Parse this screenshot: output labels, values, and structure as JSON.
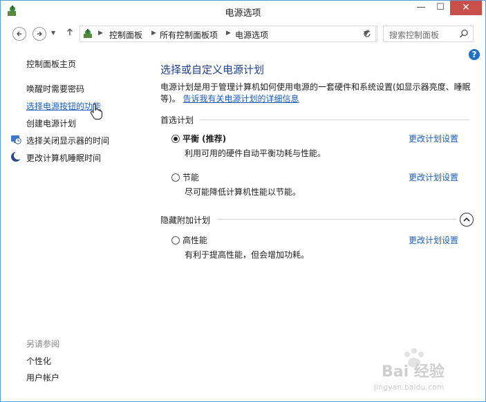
{
  "window": {
    "title": "电源选项",
    "minimize": "—",
    "maximize": "☐",
    "close": "✕"
  },
  "nav": {
    "back_icon": "arrow-left-icon",
    "forward_icon": "arrow-right-icon",
    "up_icon": "arrow-up-icon",
    "breadcrumb": [
      "控制面板",
      "所有控制面板项",
      "电源选项"
    ],
    "search_placeholder": "搜索控制面板"
  },
  "sidebar": {
    "home": "控制面板主页",
    "links": [
      {
        "label": "唤醒时需要密码",
        "icon": ""
      },
      {
        "label": "选择电源按钮的功能",
        "icon": ""
      },
      {
        "label": "创建电源计划",
        "icon": ""
      },
      {
        "label": "选择关闭显示器的时间",
        "icon": "monitor-clock-icon"
      },
      {
        "label": "更改计算机睡眠时间",
        "icon": "moon-icon"
      }
    ],
    "see_also": "另请参阅",
    "see_also_links": [
      "个性化",
      "用户帐户"
    ]
  },
  "main": {
    "title": "选择或自定义电源计划",
    "description": "电源计划是用于管理计算机如何使用电源的一套硬件和系统设置(如显示器亮度、睡眠",
    "description_end": "等)。",
    "learn_more": "告诉我有关电源计划的详细信息",
    "preferred_heading": "首选计划",
    "hidden_heading": "隐藏附加计划",
    "change_link": "更改计划设置",
    "plans": [
      {
        "name": "平衡 (推荐)",
        "desc": "利用可用的硬件自动平衡功耗与性能。",
        "selected": true
      },
      {
        "name": "节能",
        "desc": "尽可能降低计算机性能以节能。",
        "selected": false
      }
    ],
    "hidden_plans": [
      {
        "name": "高性能",
        "desc": "有利于提高性能，但会增加功耗。",
        "selected": false
      }
    ]
  },
  "watermark": {
    "text": "Bai 经验",
    "sub": "jingyan.baidu.com"
  },
  "colors": {
    "accent": "#1e5eb6",
    "title": "#1e3f8a",
    "close": "#c7504b"
  }
}
